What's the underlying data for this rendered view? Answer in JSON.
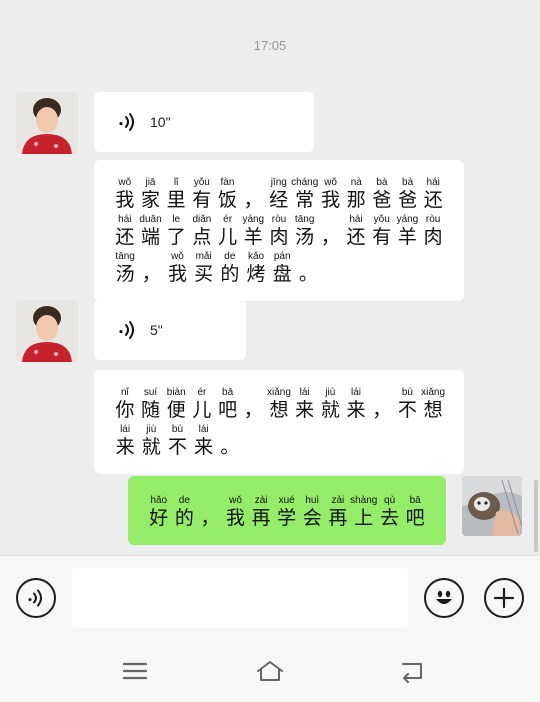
{
  "chat": {
    "timestamp": "17:05",
    "messages": [
      {
        "type": "voice",
        "sender": "contact",
        "duration": "10\""
      },
      {
        "type": "text",
        "sender": "contact",
        "lines": [
          [
            [
              "wǒ",
              "我"
            ],
            [
              "jiā",
              "家"
            ],
            [
              "lǐ",
              "里"
            ],
            [
              "yǒu",
              "有"
            ],
            [
              "fàn",
              "饭"
            ],
            [
              "",
              "，"
            ],
            [
              "jīng",
              "经"
            ],
            [
              "cháng",
              "常"
            ],
            [
              "wǒ",
              "我"
            ],
            [
              "nà",
              "那"
            ],
            [
              "bà",
              "爸"
            ],
            [
              "bà",
              "爸"
            ],
            [
              "hái",
              "还"
            ]
          ],
          [
            [
              "hái",
              "还"
            ],
            [
              "duān",
              "端"
            ],
            [
              "le",
              "了"
            ],
            [
              "diǎn",
              "点"
            ],
            [
              "ér",
              "儿"
            ],
            [
              "yáng",
              "羊"
            ],
            [
              "ròu",
              "肉"
            ],
            [
              "tāng",
              "汤"
            ],
            [
              "",
              "，"
            ],
            [
              "hái",
              "还"
            ],
            [
              "yǒu",
              "有"
            ],
            [
              "yáng",
              "羊"
            ],
            [
              "ròu",
              "肉"
            ]
          ],
          [
            [
              "tāng",
              "汤"
            ],
            [
              "",
              "，"
            ],
            [
              "wǒ",
              "我"
            ],
            [
              "mǎi",
              "买"
            ],
            [
              "de",
              "的"
            ],
            [
              "kǎo",
              "烤"
            ],
            [
              "pán",
              "盘"
            ],
            [
              "",
              "。"
            ]
          ]
        ]
      },
      {
        "type": "voice",
        "sender": "contact",
        "duration": "5\""
      },
      {
        "type": "text",
        "sender": "contact",
        "lines": [
          [
            [
              "nǐ",
              "你"
            ],
            [
              "suí",
              "随"
            ],
            [
              "biàn",
              "便"
            ],
            [
              "ér",
              "儿"
            ],
            [
              "bā",
              "吧"
            ],
            [
              "",
              "，"
            ],
            [
              "xiǎng",
              "想"
            ],
            [
              "lái",
              "来"
            ],
            [
              "jiù",
              "就"
            ],
            [
              "lái",
              "来"
            ],
            [
              "",
              "，"
            ],
            [
              "bù",
              "不"
            ],
            [
              "xiǎng",
              "想"
            ]
          ],
          [
            [
              "lái",
              "来"
            ],
            [
              "jiù",
              "就"
            ],
            [
              "bù",
              "不"
            ],
            [
              "lái",
              "来"
            ],
            [
              "",
              "。"
            ]
          ]
        ]
      },
      {
        "type": "text",
        "sender": "self",
        "lines": [
          [
            [
              "hǎo",
              "好"
            ],
            [
              "de",
              "的"
            ],
            [
              "",
              "，"
            ],
            [
              "wǒ",
              "我"
            ],
            [
              "zài",
              "再"
            ],
            [
              "xué",
              "学"
            ],
            [
              "huì",
              "会"
            ],
            [
              "zài",
              "再"
            ],
            [
              "shàng",
              "上"
            ],
            [
              "qù",
              "去"
            ],
            [
              "bā",
              "吧"
            ]
          ]
        ]
      }
    ]
  },
  "input": {
    "placeholder": ""
  },
  "icons": {
    "voice": "voice-wave-icon",
    "emoji": "smiley-face-icon",
    "add": "plus-icon",
    "menu": "menu-icon",
    "home": "home-icon",
    "back": "back-icon"
  },
  "colors": {
    "background": "#ededed",
    "incoming_bubble": "#ffffff",
    "outgoing_bubble": "#95ec69"
  }
}
